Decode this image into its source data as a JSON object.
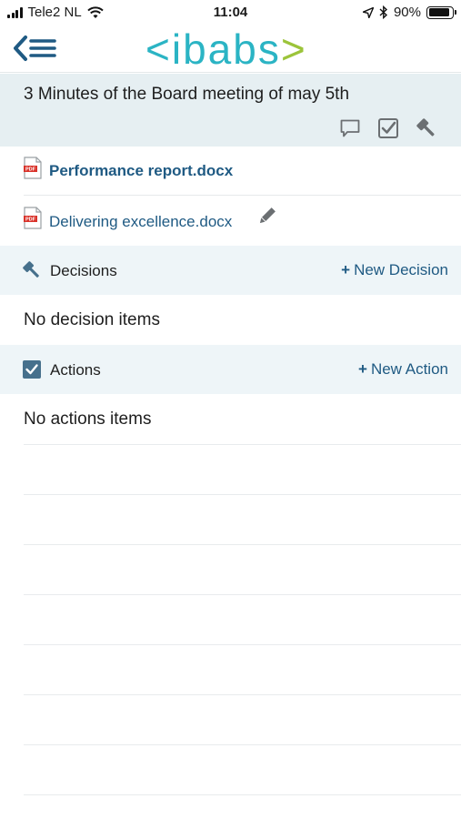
{
  "status_bar": {
    "carrier": "Tele2 NL",
    "time": "11:04",
    "battery_text": "90%",
    "battery_level": 0.9
  },
  "nav": {
    "menu_icon": "back-menu-icon",
    "logo": {
      "left_bracket": "<",
      "word": "ibabs",
      "right_bracket": ">"
    }
  },
  "header": {
    "title": "3 Minutes of the Board meeting of may 5th",
    "icons": [
      "comment-icon",
      "checkbox-icon",
      "gavel-icon"
    ]
  },
  "documents": [
    {
      "name": "Performance report.docx",
      "icon": "pdf-icon"
    },
    {
      "name": "Delivering excellence.docx",
      "icon": "pdf-icon",
      "edit_icon": "pencil-icon"
    }
  ],
  "decisions": {
    "label": "Decisions",
    "icon": "gavel-icon",
    "plus": "+",
    "new_label": "New Decision",
    "empty_text": "No decision items"
  },
  "actions": {
    "label": "Actions",
    "icon": "checkbox-icon",
    "plus": "+",
    "new_label": "New Action",
    "empty_text": "No actions items"
  },
  "colors": {
    "accent_link": "#1f5a83",
    "logo_teal": "#2bb4c4",
    "logo_green": "#9cc43a",
    "header_bg": "#e6eff2",
    "section_bg": "#eef5f8"
  }
}
